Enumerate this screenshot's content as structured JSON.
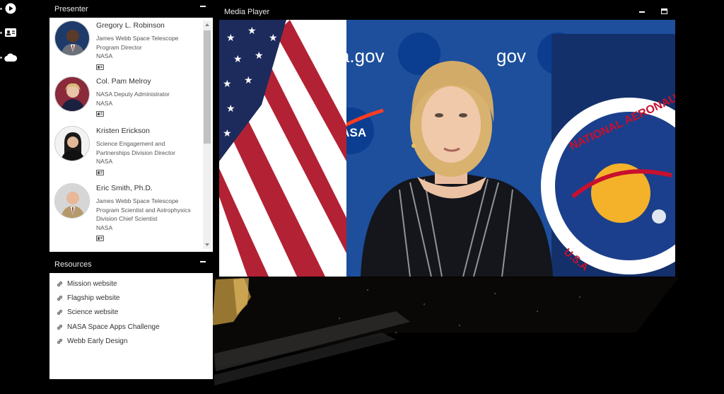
{
  "rail": {
    "icons": [
      "play-circle-icon",
      "contact-card-icon",
      "cloud-icon"
    ]
  },
  "presenter_panel": {
    "title": "Presenter",
    "presenters": [
      {
        "name": "Gregory L. Robinson",
        "role": "James Webb Space Telescope Program Director",
        "org": "NASA"
      },
      {
        "name": "Col. Pam Melroy",
        "role": "NASA Deputy Administrator",
        "org": "NASA"
      },
      {
        "name": "Kristen Erickson",
        "role": "Science Engagement and Partnerships Division Director",
        "org": "NASA"
      },
      {
        "name": "Eric Smith, Ph.D.",
        "role": "James Webb Space Telescope Program Scientist and Astrophysics Division Chief Scientist",
        "org": "NASA"
      }
    ]
  },
  "resources_panel": {
    "title": "Resources",
    "links": [
      "Mission website",
      "Flagship website",
      "Science website",
      "NASA Space Apps Challenge",
      "Webb Early Design"
    ]
  },
  "media_player": {
    "title": "Media Player",
    "backdrop_text": "nasa.gov",
    "backdrop_text_partial": "gov",
    "logo_text": "NASA",
    "seal_top": "NATIONAL AERONAUTICS",
    "seal_bottom": "U.S.A"
  },
  "colors": {
    "panel_bg": "#ffffff",
    "header_bg": "#000000",
    "nasa_blue": "#0b3d91",
    "nasa_red": "#fc3d21",
    "flag_red": "#b22234"
  }
}
